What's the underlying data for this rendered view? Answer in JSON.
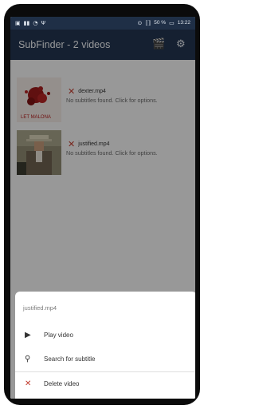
{
  "status_bar": {
    "left_glyphs": [
      "▣",
      "▮▮",
      "◔",
      "Ψ"
    ],
    "right_glyphs": [
      "⊙",
      "⟦⟧",
      "▭"
    ],
    "battery_percent": "50 %",
    "time": "13:22"
  },
  "app_bar": {
    "title": "SubFinder - 2 videos",
    "icons": [
      "clapperboard-icon",
      "gear-icon"
    ],
    "colors": {
      "bar": "#22344f",
      "status": "#1f2f46"
    }
  },
  "videos": [
    {
      "filename": "dexter.mp4",
      "message": "No subtitles found. Click for options.",
      "thumbnail_text": "LET MALONA",
      "status_icon": "close-icon"
    },
    {
      "filename": "justified.mp4",
      "message": "No subtitles found. Click for options.",
      "status_icon": "close-icon"
    }
  ],
  "bottom_sheet": {
    "title": "justified.mp4",
    "options": [
      {
        "label": "Play video",
        "icon": "play-icon",
        "glyph": "▶"
      },
      {
        "label": "Search for subtitle",
        "icon": "search-icon",
        "glyph": "⚲"
      },
      {
        "label": "Delete video",
        "icon": "close-icon",
        "glyph": "✕"
      }
    ]
  },
  "glyphs": {
    "close": "✕",
    "gear": "⚙",
    "clapper": "🎬"
  }
}
